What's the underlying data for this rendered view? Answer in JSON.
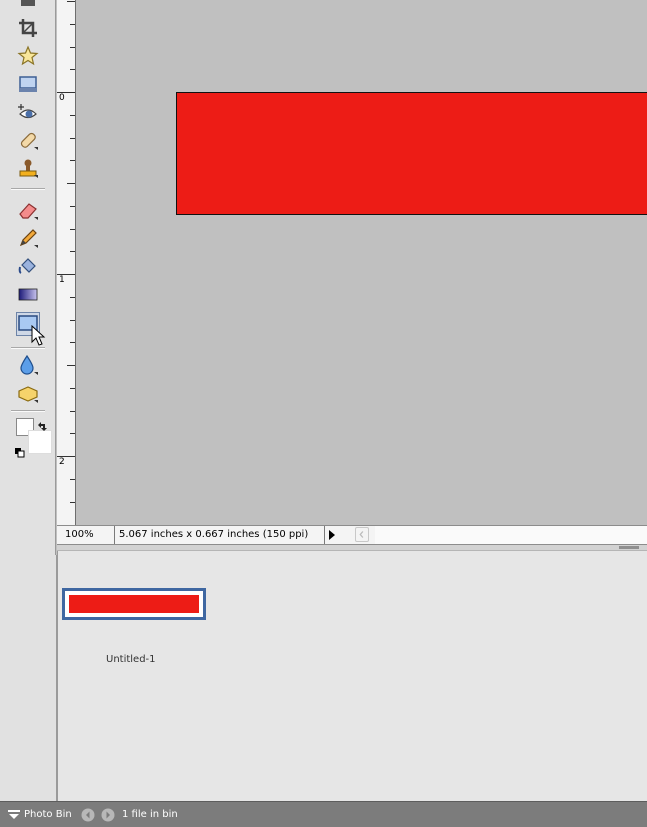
{
  "toolbar": {
    "tools": [
      {
        "icon": "crop-icon"
      },
      {
        "icon": "cookie-cutter-icon"
      },
      {
        "icon": "straighten-icon"
      },
      {
        "icon": "red-eye-removal-icon"
      },
      {
        "icon": "spot-healing-brush-icon"
      },
      {
        "icon": "clone-stamp-icon"
      },
      {
        "icon": "eraser-icon"
      },
      {
        "icon": "pencil-icon"
      },
      {
        "icon": "paint-bucket-icon"
      },
      {
        "icon": "gradient-icon"
      },
      {
        "icon": "rectangle-shape-icon",
        "selected": true
      },
      {
        "icon": "blur-icon"
      },
      {
        "icon": "sponge-icon"
      }
    ],
    "colors": {
      "foreground": "#ffffff",
      "background": "#ffffff"
    }
  },
  "ruler": {
    "labels": [
      "0",
      "1",
      "2"
    ]
  },
  "canvas": {
    "background": "#c0c0c0",
    "shape_fill": "#ed1c16"
  },
  "statusbar": {
    "zoom": "100%",
    "doc_info": "5.067 inches x 0.667 inches (150 ppi)"
  },
  "photobin": {
    "thumbnail_label": "Untitled-1",
    "bar_title": "Photo Bin",
    "file_count": "1 file in bin"
  }
}
